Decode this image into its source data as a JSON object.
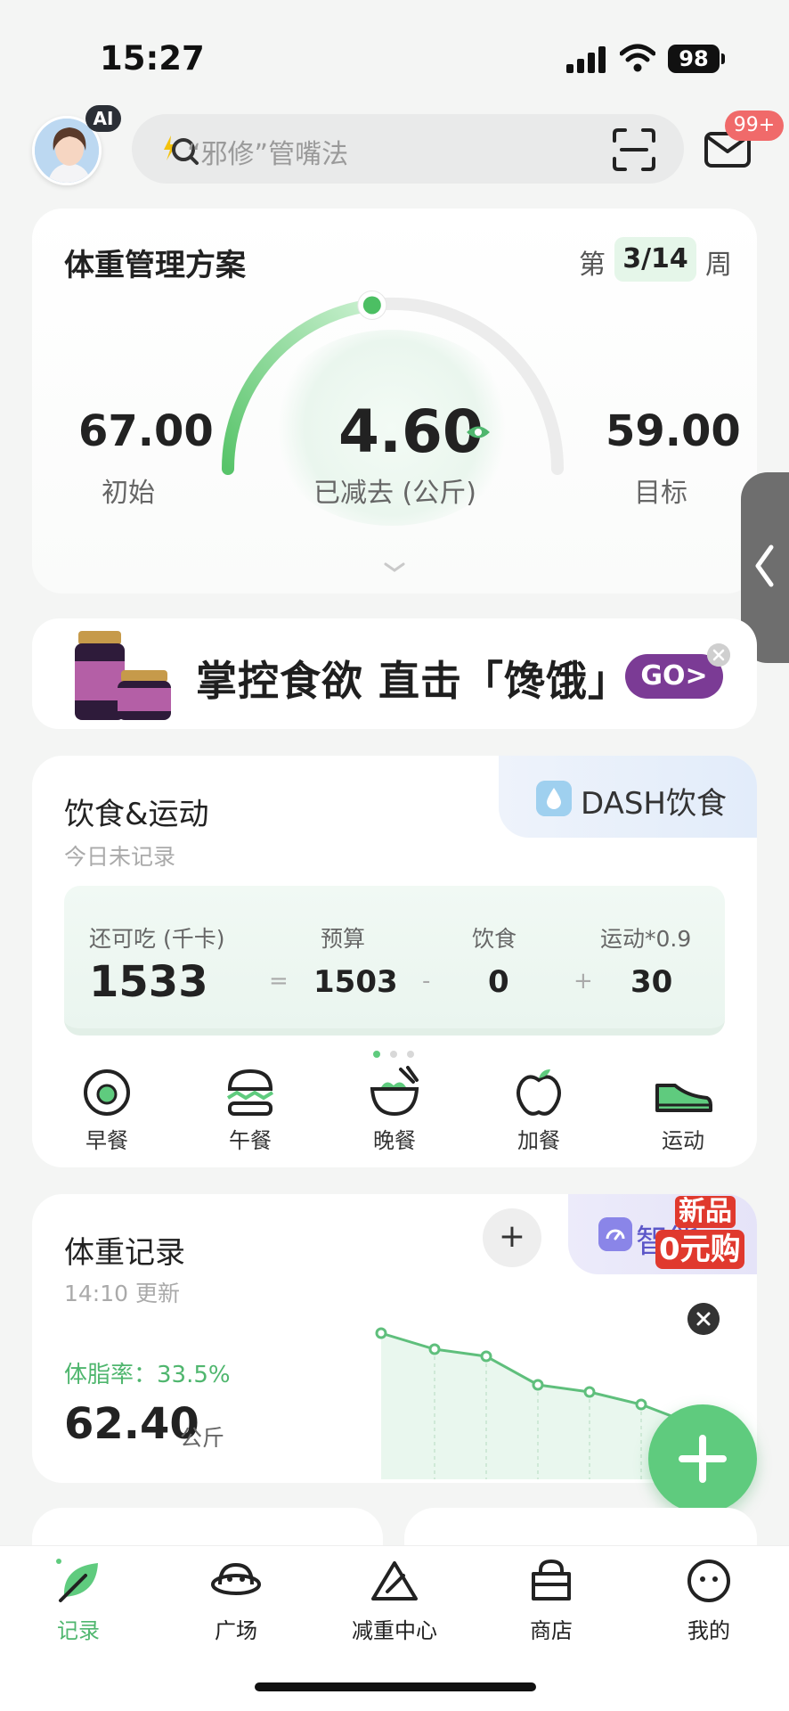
{
  "status_bar": {
    "time": "15:27",
    "battery": "98"
  },
  "header": {
    "ai_badge": "AI",
    "search_placeholder": "“邪修”管嘴法",
    "mail_badge": "99+"
  },
  "plan": {
    "title": "体重管理方案",
    "week_prefix": "第",
    "week_value": "3/14",
    "week_suffix": "周",
    "initial_value": "67.00",
    "initial_label": "初始",
    "lost_value": "4.60",
    "lost_label": "已减去 (公斤)",
    "target_value": "59.00",
    "target_label": "目标",
    "progress_fraction": 0.46
  },
  "ad": {
    "text": "掌控食欲 直击「馋饿」",
    "go_label": "GO>"
  },
  "diet": {
    "title": "饮食&运动",
    "subtitle": "今日未记录",
    "dash_label": "DASH饮食",
    "remaining_label": "还可吃 (千卡)",
    "remaining_value": "1533",
    "budget_label": "预算",
    "budget_value": "1503",
    "food_label": "饮食",
    "food_value": "0",
    "exercise_label": "运动*0.9",
    "exercise_value": "30",
    "op_eq": "=",
    "op_minus": "-",
    "op_plus": "+",
    "meals": [
      {
        "label": "早餐",
        "icon": "egg-icon"
      },
      {
        "label": "午餐",
        "icon": "burger-icon"
      },
      {
        "label": "晚餐",
        "icon": "bowl-icon"
      },
      {
        "label": "加餐",
        "icon": "apple-icon"
      },
      {
        "label": "运动",
        "icon": "sneaker-icon"
      }
    ]
  },
  "weight": {
    "title": "体重记录",
    "updated": "14:10 更新",
    "add_label": "+",
    "smart_label": "智能",
    "promo_line1": "新品",
    "promo_line2": "0元购",
    "body_fat": "体脂率：33.5%",
    "value": "62.40",
    "unit": "公斤"
  },
  "nav": {
    "items": [
      {
        "label": "记录",
        "icon": "leaf-icon",
        "active": true
      },
      {
        "label": "广场",
        "icon": "planet-icon"
      },
      {
        "label": "减重中心",
        "icon": "triangle-icon"
      },
      {
        "label": "商店",
        "icon": "bag-icon"
      },
      {
        "label": "我的",
        "icon": "face-icon"
      }
    ]
  },
  "colors": {
    "accent_green": "#5fcb7e",
    "go_purple": "#7b3b95",
    "badge_red": "#f06a6a"
  }
}
